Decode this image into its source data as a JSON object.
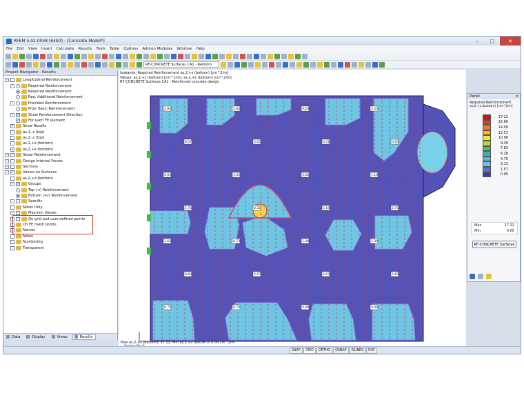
{
  "window": {
    "title": "RFEM 5.02.0048 (64bit) - [Concrete Model*]"
  },
  "menu": [
    "File",
    "Edit",
    "View",
    "Insert",
    "Calculate",
    "Results",
    "Tools",
    "Table",
    "Options",
    "Add-on Modules",
    "Window",
    "Help"
  ],
  "toolbar": {
    "module_combo": "RF-CONCRETE Surfaces CA1 - Reinforo"
  },
  "navigator": {
    "title": "Project Navigator - Results",
    "items": [
      {
        "label": "Longitudinal Reinforcement",
        "indent": 1,
        "ctl": "exp-cb",
        "checked": false
      },
      {
        "label": "Required Reinforcement",
        "indent": 2,
        "ctl": "exp-rb",
        "on": false
      },
      {
        "label": "Required Reinforcement",
        "indent": 3,
        "ctl": "rb",
        "on": true
      },
      {
        "label": "Req. Additional Reinforcement",
        "indent": 3,
        "ctl": "rb",
        "on": false
      },
      {
        "label": "Provided Reinforcement",
        "indent": 2,
        "ctl": "exp-rb",
        "on": false
      },
      {
        "label": "Prov. Basic Reinforcement",
        "indent": 3,
        "ctl": "rb",
        "on": false
      },
      {
        "label": "Show Reinforcement Direction",
        "indent": 2,
        "ctl": "exp-cb",
        "checked": true
      },
      {
        "label": "For each FE element",
        "indent": 3,
        "ctl": "cb",
        "checked": true
      },
      {
        "label": "Show Results",
        "indent": 2,
        "ctl": "cb",
        "checked": true
      },
      {
        "label": "as,1,-z (top)",
        "indent": 2,
        "ctl": "cb",
        "checked": false
      },
      {
        "label": "as,2,-z (top)",
        "indent": 2,
        "ctl": "cb",
        "checked": false
      },
      {
        "label": "as,1,+z (bottom)",
        "indent": 2,
        "ctl": "cb",
        "checked": false
      },
      {
        "label": "as,2,+z (bottom)",
        "indent": 2,
        "ctl": "cb",
        "checked": true
      },
      {
        "label": "Shear Reinforcement",
        "indent": 1,
        "ctl": "exp-cb",
        "checked": false
      },
      {
        "label": "Design Internal Forces",
        "indent": 1,
        "ctl": "exp-cb",
        "checked": false
      },
      {
        "label": "Sections",
        "indent": 1,
        "ctl": "exp-cb",
        "checked": false
      },
      {
        "label": "Values on Surfaces",
        "indent": 1,
        "ctl": "exp-cb",
        "checked": true
      },
      {
        "label": "as,2,+z (bottom)",
        "indent": 2,
        "ctl": "cb",
        "checked": false
      },
      {
        "label": "Groups",
        "indent": 2,
        "ctl": "exp-cb",
        "checked": true
      },
      {
        "label": "Top (-z) Reinforcement",
        "indent": 3,
        "ctl": "rb",
        "on": false
      },
      {
        "label": "Bottom (+z) Reinforcement",
        "indent": 3,
        "ctl": "rb",
        "on": true
      },
      {
        "label": "Specific",
        "indent": 2,
        "ctl": "exp-cb",
        "checked": false
      },
      {
        "label": "Notes Only",
        "indent": 2,
        "ctl": "cb",
        "checked": false
      },
      {
        "label": "Max/min Values",
        "indent": 2,
        "ctl": "exp-cb",
        "checked": false
      },
      {
        "label": "On grid and user-defined points",
        "indent": 2,
        "ctl": "exp-cb",
        "checked": false
      },
      {
        "label": "On FE mesh points",
        "indent": 2,
        "ctl": "cb",
        "checked": false
      },
      {
        "label": "Names",
        "indent": 2,
        "ctl": "cb",
        "checked": false
      },
      {
        "label": "Notes",
        "indent": 2,
        "ctl": "cb",
        "checked": false
      },
      {
        "label": "Numbering",
        "indent": 2,
        "ctl": "cb",
        "checked": false
      },
      {
        "label": "Transparent",
        "indent": 2,
        "ctl": "cb",
        "checked": false
      }
    ],
    "tabs": [
      "Data",
      "Display",
      "Views",
      "Results"
    ]
  },
  "view": {
    "info_lines": [
      "Isobands: Required Reinforcement as,2,+z (bottom) [cm^2/m]",
      "Values: as,2,+z (bottom) [cm^2/m], as,2,+z (bottom) [cm^2/m]",
      "RF-CONCRETE Surfaces CA1 - Reinforced concrete design"
    ],
    "footer": "Max as,2,+z (bottom): 17.22, Min as,2,+z (bottom): 0.00 cm^2/m",
    "value_labels": [
      "2.93",
      "2.64",
      "0.29",
      "3.55",
      "0.07",
      "3.65",
      "0.01",
      "0.00",
      "0.05",
      "3.65",
      "3.62",
      "1.16",
      "2.75",
      "0.32",
      "5.19",
      "2.75",
      "3.65",
      "0.73",
      "1.40",
      "1.30",
      "0.83",
      "3.57",
      "2.63",
      "2.60",
      "0.73",
      "0.72",
      "0.00",
      "0.00"
    ],
    "axis_label": "Section Plcz2",
    "colors": {
      "dark": "#5454b8",
      "light": "#6ec6e4",
      "hot": "#d83030"
    }
  },
  "panel": {
    "title": "Panel",
    "subtitle": "Required Reinforcement",
    "unit": "as,2,+z (bottom) [cm^2/m]",
    "legend": [
      {
        "value": "17.22",
        "color": "#c81414"
      },
      {
        "value": "15.66",
        "color": "#e83a18"
      },
      {
        "value": "14.09",
        "color": "#f37a1e"
      },
      {
        "value": "12.53",
        "color": "#f7b428"
      },
      {
        "value": "10.96",
        "color": "#f4e430"
      },
      {
        "value": "9.39",
        "color": "#b4d838"
      },
      {
        "value": "7.83",
        "color": "#58c048"
      },
      {
        "value": "6.26",
        "color": "#3cb8a0"
      },
      {
        "value": "4.70",
        "color": "#58b6e0"
      },
      {
        "value": "3.13",
        "color": "#6ec6e4"
      },
      {
        "value": "1.57",
        "color": "#5a70d0"
      },
      {
        "value": "0.00",
        "color": "#3c3ca8"
      }
    ],
    "max_label": "Max",
    "max_value": "17.22",
    "min_label": "Min",
    "min_value": "0.00",
    "button": "RF-CONCRETE Surfaces"
  },
  "status": [
    "SNAP",
    "GRID",
    "ORTHO",
    "OSNAP",
    "GLINES",
    "DXF"
  ]
}
